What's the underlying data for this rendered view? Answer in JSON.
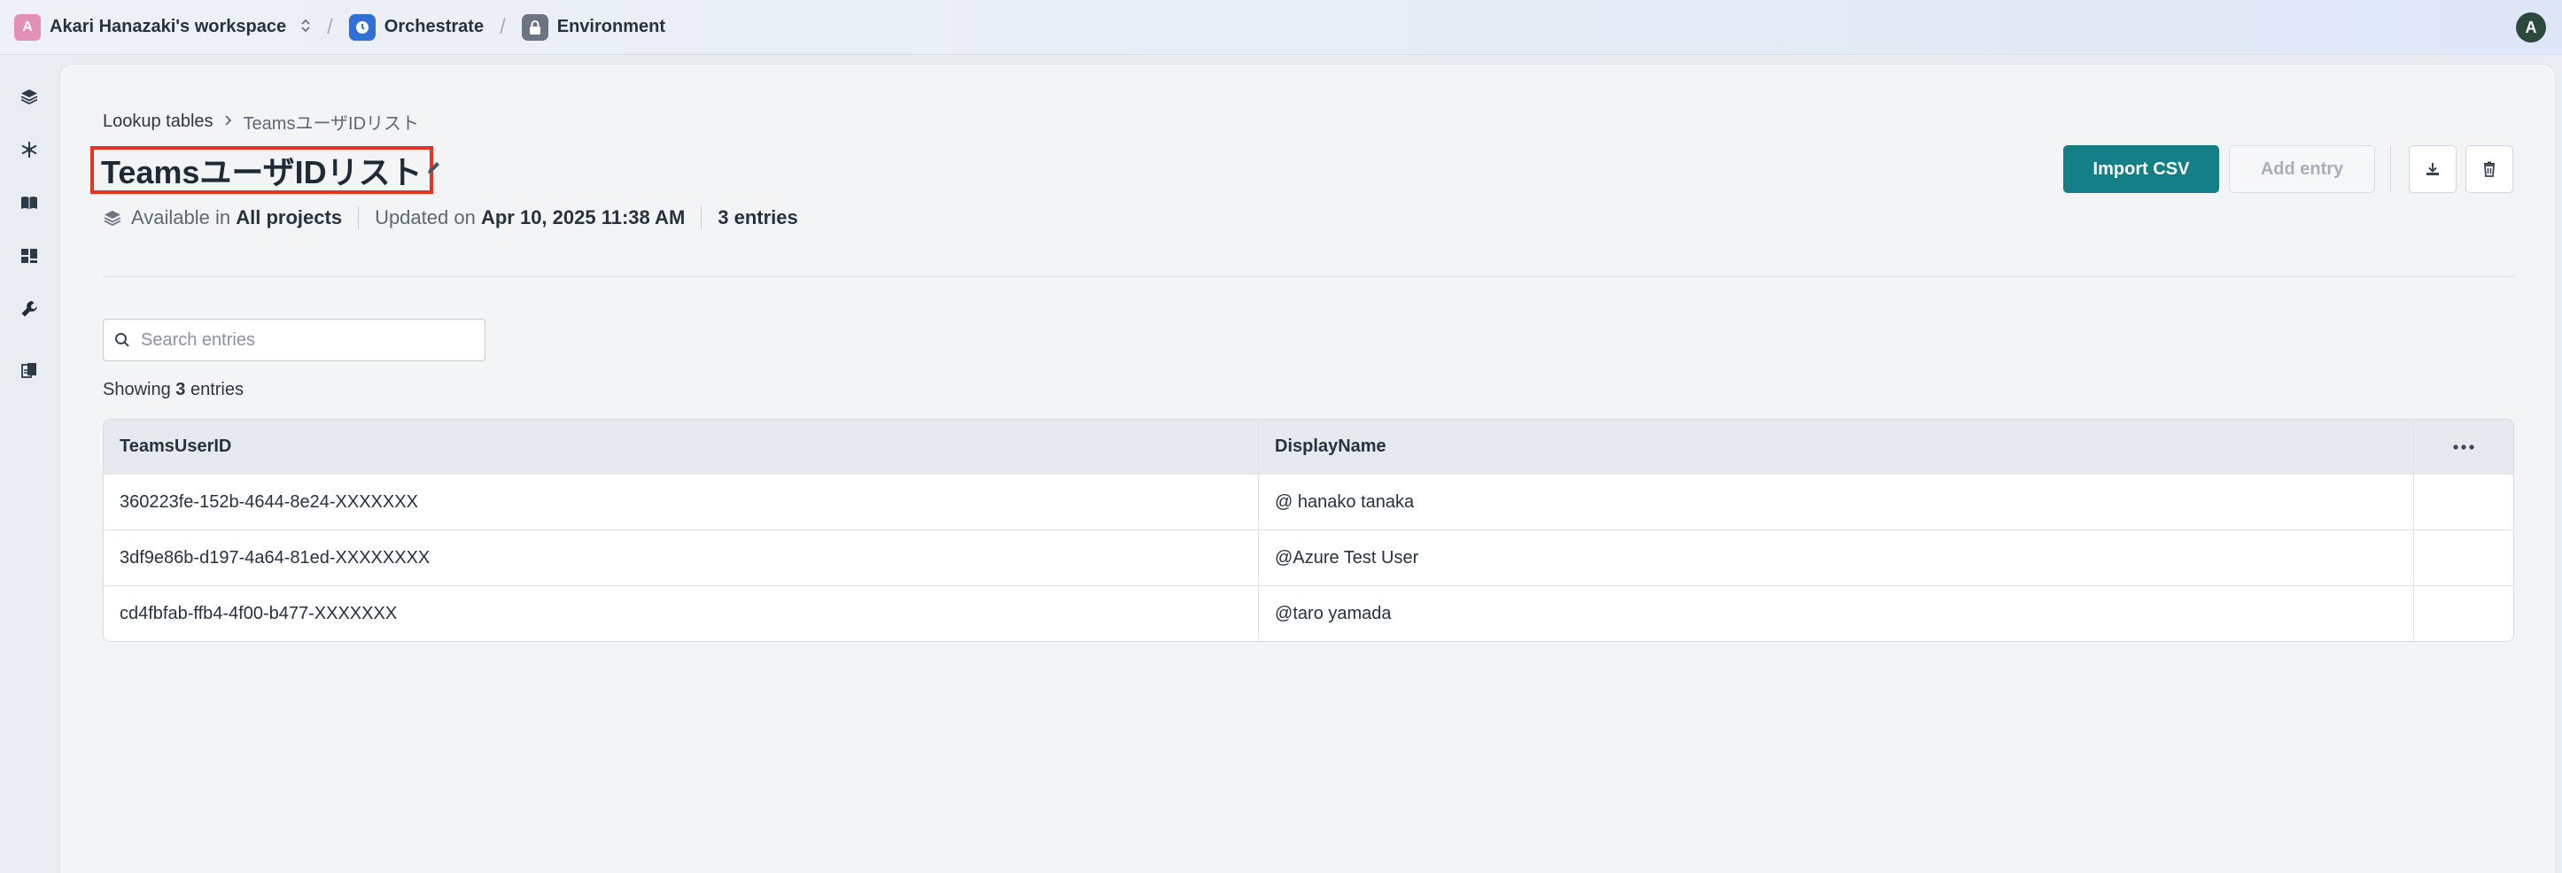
{
  "topbar": {
    "workspace_initial": "A",
    "workspace_name": "Akari Hanazaki's workspace",
    "product": "Orchestrate",
    "section": "Environment",
    "user_initial": "A"
  },
  "breadcrumb": {
    "parent": "Lookup tables",
    "current": "TeamsユーザIDリスト"
  },
  "header": {
    "title": "TeamsユーザIDリスト",
    "availability_prefix": "Available in",
    "availability_value": "All projects",
    "updated_prefix": "Updated on",
    "updated_value": "Apr 10, 2025 11:38 AM",
    "entries_count": "3 entries"
  },
  "actions": {
    "import_label": "Import CSV",
    "add_label": "Add entry"
  },
  "search": {
    "placeholder": "Search entries",
    "value": ""
  },
  "showing": {
    "prefix": "Showing",
    "count": "3",
    "suffix": "entries"
  },
  "table": {
    "columns": [
      "TeamsUserID",
      "DisplayName"
    ],
    "rows": [
      [
        "360223fe-152b-4644-8e24-XXXXXXX",
        "@ hanako tanaka"
      ],
      [
        "3df9e86b-d197-4a64-81ed-XXXXXXXX",
        "@Azure Test User"
      ],
      [
        "cd4fbfab-ffb4-4f00-b477-XXXXXXX",
        "@taro yamada"
      ]
    ]
  },
  "colors": {
    "accent": "#147f87",
    "highlight_border": "#e8321f",
    "orchestrate_icon": "#2f6fd6",
    "workspace_avatar": "#e48fb6"
  }
}
